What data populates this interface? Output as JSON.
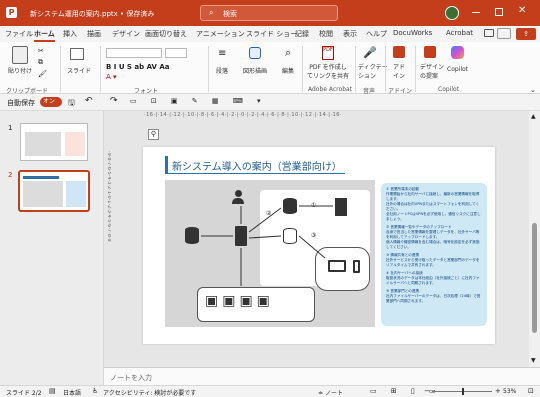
{
  "window": {
    "title": "新システム運用の案内.pptx • 保存済み",
    "search_placeholder": "検索",
    "autosave_label": "自動保存",
    "autosave_state": "オン",
    "accent": "#c43e1c"
  },
  "tabs": [
    "ファイル",
    "ホーム",
    "挿入",
    "描画",
    "デザイン",
    "画面切り替え",
    "アニメーション",
    "スライド ショー",
    "記録",
    "校閲",
    "表示",
    "ヘルプ",
    "DocuWorks",
    "Acrobat"
  ],
  "ribbon": {
    "paste": "貼り付け",
    "new_slide": "スライド",
    "paragraph": "段落",
    "draw_shapes": "図形描画",
    "editing": "編集",
    "pdf_share": "PDF を作成し\nてリンクを共有",
    "dictation": "ディクテー\nション",
    "addins": "アド\nイン",
    "designer": "デザイン\nの提案",
    "copilot": "Copilot",
    "groups": {
      "clipboard": "クリップボード",
      "font": "フォント",
      "adobe": "Adobe Acrobat",
      "voice": "音声",
      "addins": "アドイン",
      "copilot": "Copilot"
    }
  },
  "ruler_h": "·16·|·14·|·12·|·10·|·8·|·6·|·4·|·2·|·0·|·2·|·4·|·6·|·8·|·10·|·12·|·14·|·16·",
  "ruler_v": "·9·8·7·6·5·4·3·2·1·0·1·2·3·4·5·6·7·8·9",
  "thumbnails": [
    {
      "number": "1"
    },
    {
      "number": "2"
    }
  ],
  "slide": {
    "title": "新システム導入の案内（営業部向け）",
    "diagram_labels": {
      "n1": "①",
      "n2": "②",
      "n3": "③"
    },
    "notes": [
      "① 営業所端末の起動\n作業開始から社内サーバに接続し、最新の営業情報を取得します。\n社外の場合は社内VPNまたはスマートフォンを利用してください。\n全社用ノートPCはVPNを必ず使用し、通信リスクに注意しましょう。",
      "② 営業情報一覧やデータのアップロード\n自身で担当した営業情報を整理しデータを、社外サーバ等を利用してアップロードします。\n個人情報や機密情報を含む場合は、暗号化設定を必ず実施してください。",
      "③ 情報共有との連携\n社外サービスから受け取ったデータと営業部門のデータをリアルタイムで共有されます。",
      "④ 社内サーバへの接続\n取扱状況のデータは本社経由（社外接続ごと）に社内ファイルサーバへと同期されます。",
      "⑤ 営業部門との連携\n社内ファイルサーバーのデータは、日次処理（24時）で営業部門へ同期されます。"
    ]
  },
  "notes_placeholder": "ノートを入力",
  "status": {
    "slide": "スライド 2/2",
    "language": "日本語",
    "accessibility": "アクセシビリティ: 検討が必要です",
    "notes": "ノート",
    "zoom": "53%"
  }
}
